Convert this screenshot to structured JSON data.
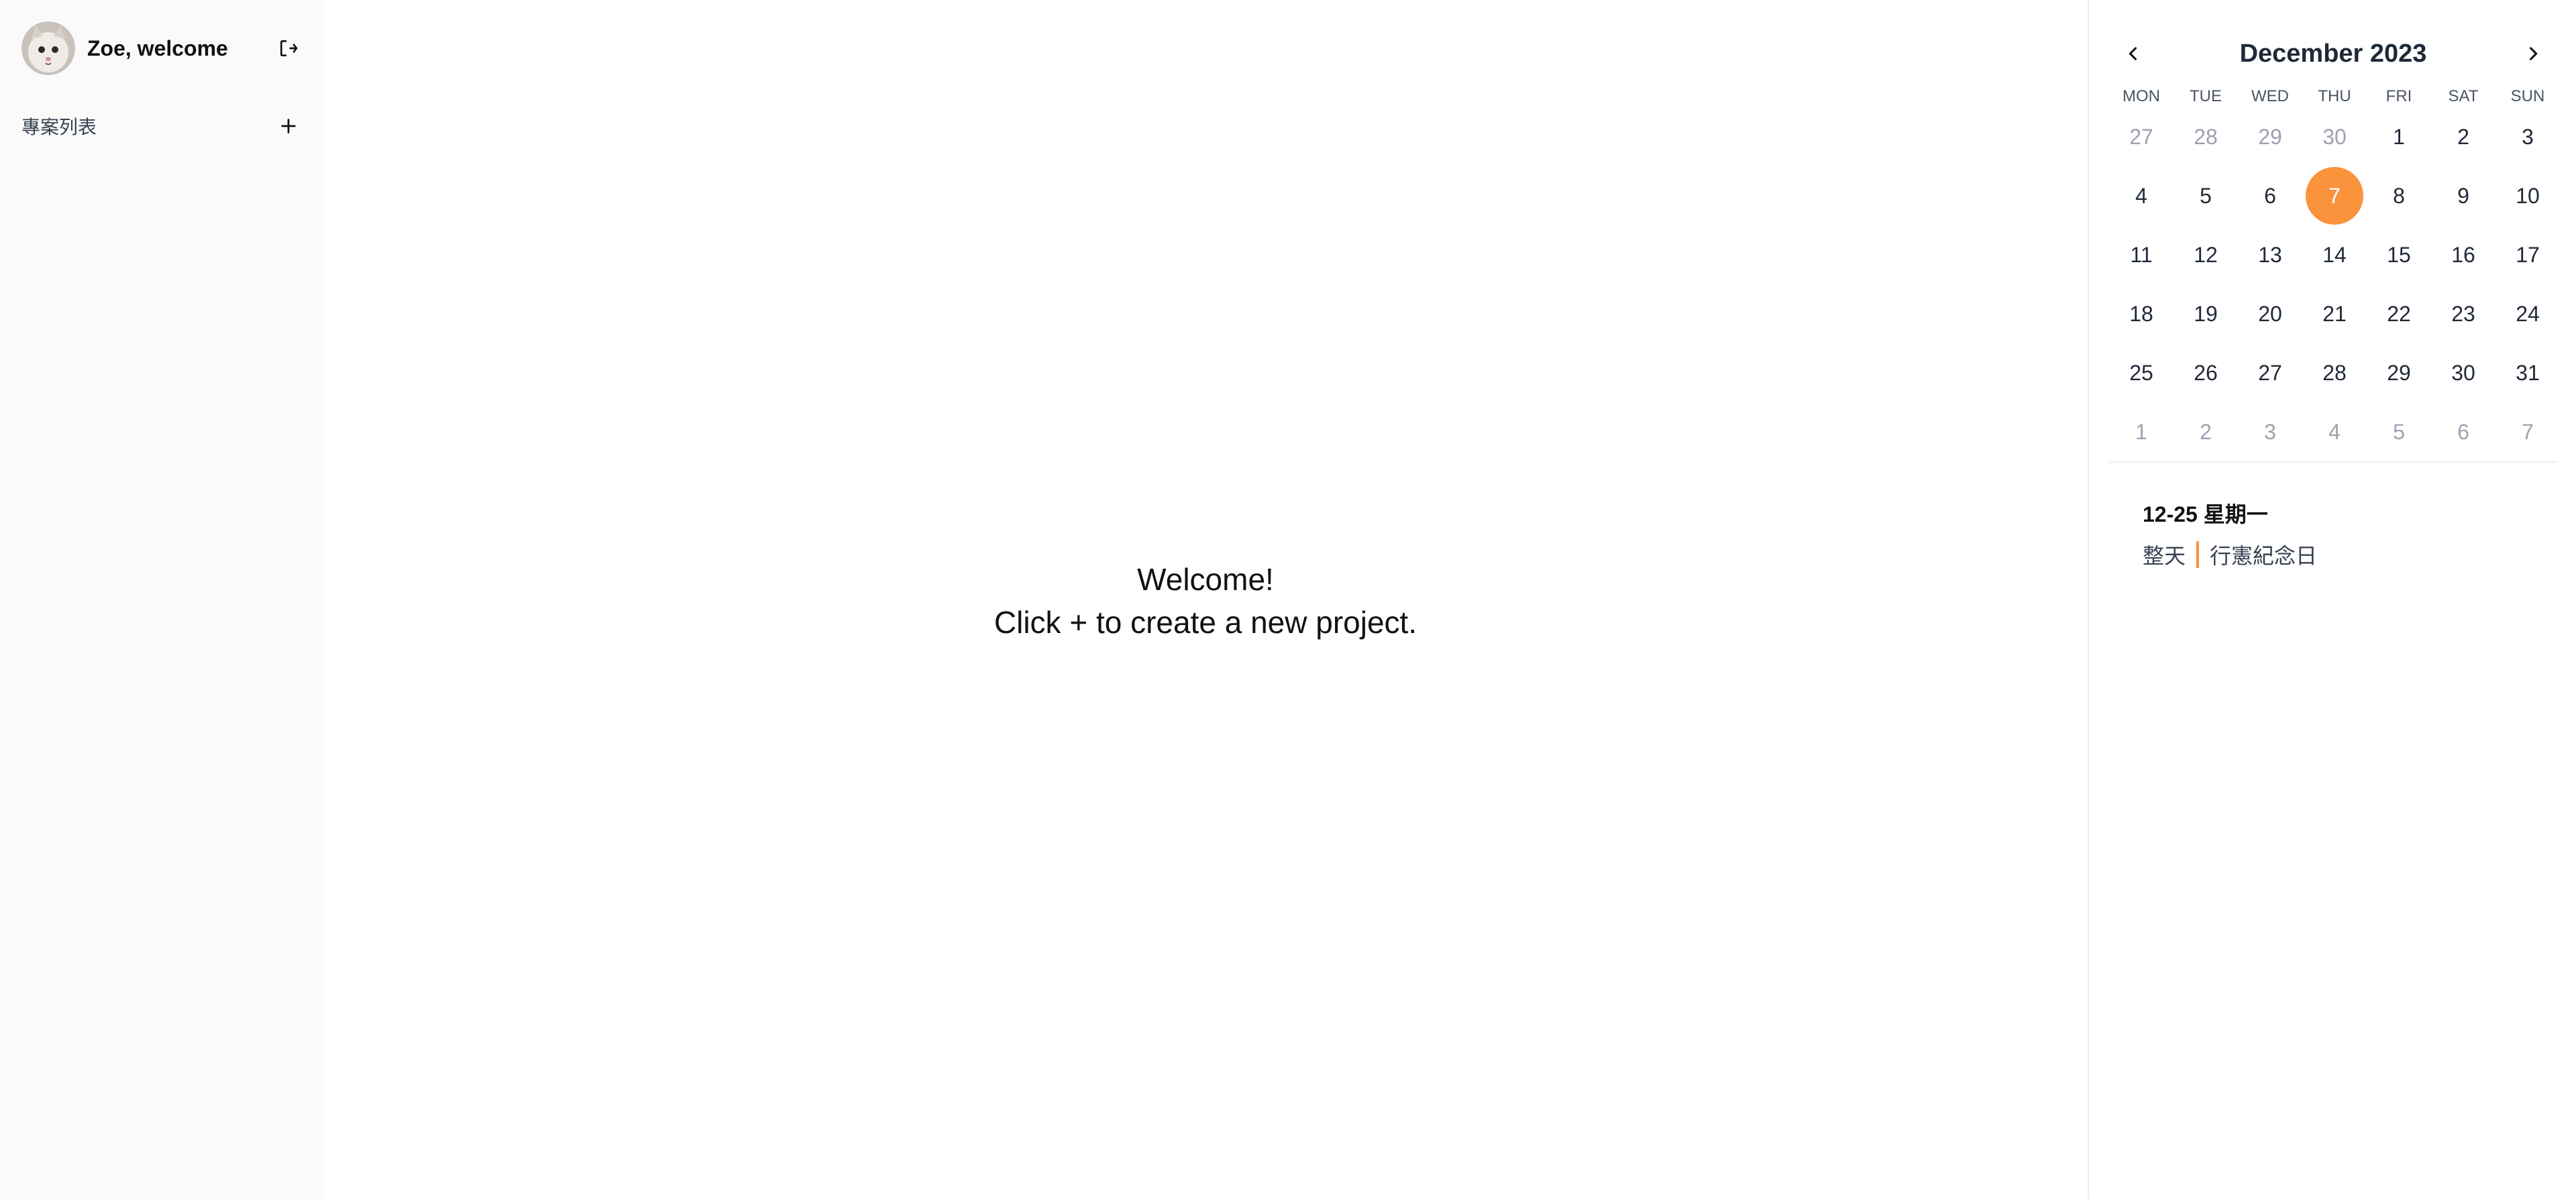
{
  "sidebar": {
    "welcome_text": "Zoe, welcome",
    "project_list_label": "專案列表",
    "icons": {
      "logout": "logout-icon",
      "add": "plus-icon"
    }
  },
  "main": {
    "welcome_line1": "Welcome!",
    "welcome_line2": "Click + to create a new project."
  },
  "calendar": {
    "month_title": "December 2023",
    "weekdays": [
      "MON",
      "TUE",
      "WED",
      "THU",
      "FRI",
      "SAT",
      "SUN"
    ],
    "days": [
      {
        "d": "27",
        "out": true
      },
      {
        "d": "28",
        "out": true
      },
      {
        "d": "29",
        "out": true
      },
      {
        "d": "30",
        "out": true
      },
      {
        "d": "1"
      },
      {
        "d": "2"
      },
      {
        "d": "3"
      },
      {
        "d": "4"
      },
      {
        "d": "5"
      },
      {
        "d": "6"
      },
      {
        "d": "7",
        "selected": true
      },
      {
        "d": "8"
      },
      {
        "d": "9"
      },
      {
        "d": "10"
      },
      {
        "d": "11"
      },
      {
        "d": "12"
      },
      {
        "d": "13"
      },
      {
        "d": "14"
      },
      {
        "d": "15"
      },
      {
        "d": "16"
      },
      {
        "d": "17"
      },
      {
        "d": "18"
      },
      {
        "d": "19"
      },
      {
        "d": "20"
      },
      {
        "d": "21"
      },
      {
        "d": "22"
      },
      {
        "d": "23"
      },
      {
        "d": "24"
      },
      {
        "d": "25"
      },
      {
        "d": "26"
      },
      {
        "d": "27"
      },
      {
        "d": "28"
      },
      {
        "d": "29"
      },
      {
        "d": "30"
      },
      {
        "d": "31"
      },
      {
        "d": "1",
        "out": true
      },
      {
        "d": "2",
        "out": true
      },
      {
        "d": "3",
        "out": true
      },
      {
        "d": "4",
        "out": true
      },
      {
        "d": "5",
        "out": true
      },
      {
        "d": "6",
        "out": true
      },
      {
        "d": "7",
        "out": true
      }
    ],
    "event": {
      "date_label": "12-25 星期一",
      "time_label": "整天",
      "title": "行憲紀念日"
    },
    "colors": {
      "accent": "#fb923c",
      "muted_day": "#9ca3af"
    }
  }
}
